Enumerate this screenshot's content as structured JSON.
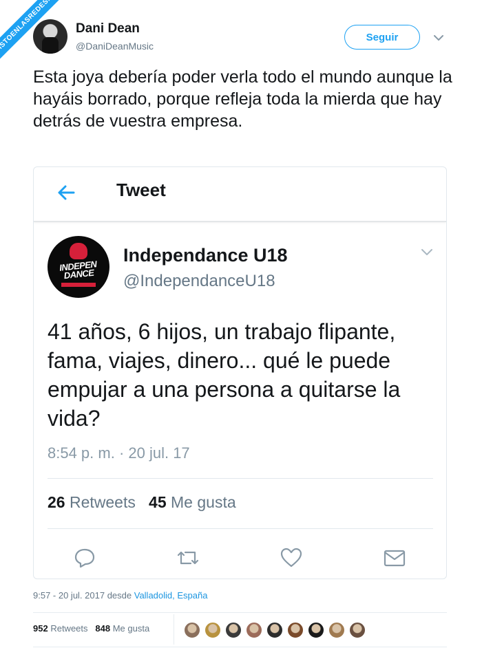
{
  "watermark": "VISTOENLASREDES.com",
  "author": {
    "name": "Dani Dean",
    "handle": "@DaniDeanMusic",
    "follow_label": "Seguir"
  },
  "tweet_text": "Esta joya debería poder verla todo el mundo aunque la hayáis borrado, porque refleja toda la mierda que hay detrás de vuestra empresa.",
  "embedded": {
    "bar_title": "Tweet",
    "logo_text": "INDEPEN DANCE",
    "name": "Independance U18",
    "handle": "@IndependanceU18",
    "text": "41 años, 6 hijos, un trabajo flipante, fama, viajes, dinero... qué le puede empujar a una persona a quitarse la vida?",
    "timestamp": "8:54 p. m. · 20 jul. 17",
    "retweets_count": "26",
    "retweets_label": "Retweets",
    "likes_count": "45",
    "likes_label": "Me gusta",
    "actions": [
      "reply-icon",
      "retweet-icon",
      "heart-icon",
      "message-icon"
    ]
  },
  "meta": {
    "time_prefix": "9:57 - 20 jul. 2017 desde ",
    "location": "Valladolid, España"
  },
  "stats": {
    "retweets_count": "952",
    "retweets_label": "Retweets",
    "likes_count": "848",
    "likes_label": "Me gusta"
  },
  "colors": {
    "accent": "#1da1f2",
    "text": "#14171a",
    "secondary": "#657786",
    "muted": "#8899a6"
  },
  "liker_avatars": [
    "#8a6f5c",
    "#b8923e",
    "#3a3a3a",
    "#9c6b5a",
    "#2c2c2c",
    "#7a4a2a",
    "#1a1a1a",
    "#a07a50",
    "#6a5040"
  ]
}
